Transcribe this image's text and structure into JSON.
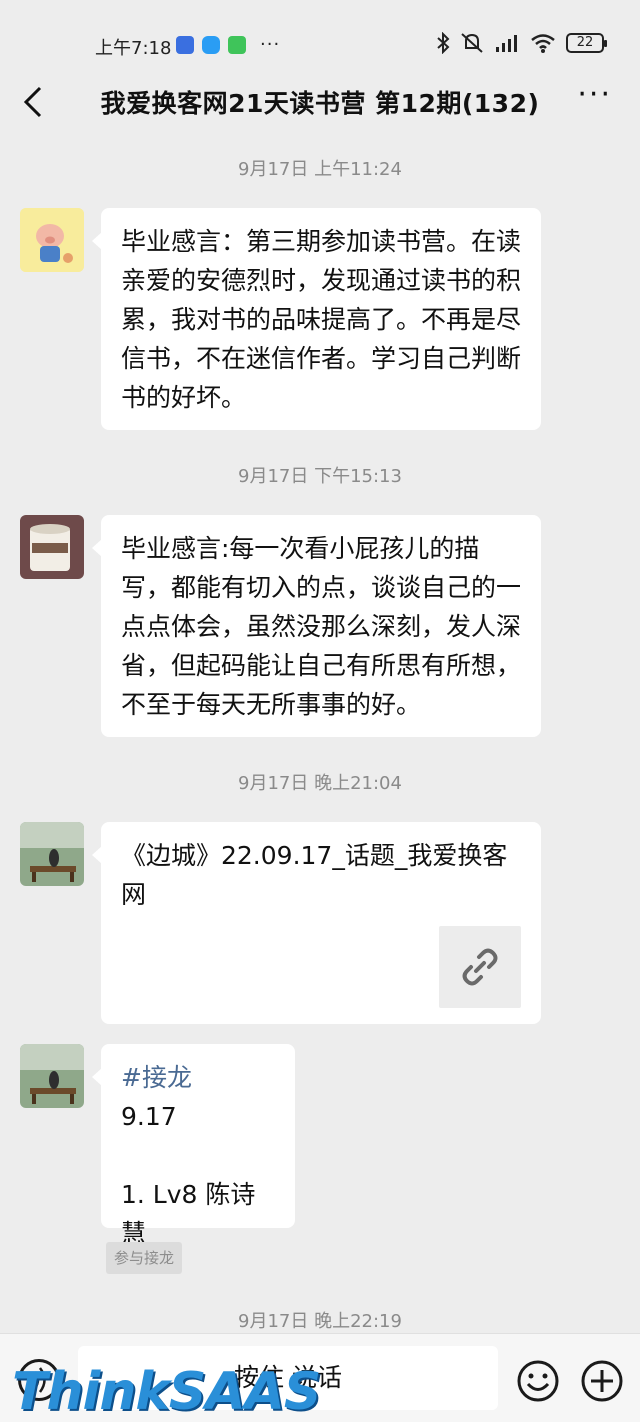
{
  "status_bar": {
    "time": "上午7:18",
    "more": "···",
    "battery": "22"
  },
  "header": {
    "title": "我爱换客网21天读书营 第12期(132)",
    "more": "···"
  },
  "messages": [
    {
      "timestamp": "9月17日 上午11:24",
      "text": "毕业感言：第三期参加读书营。在读亲爱的安德烈时，发现通过读书的积累，我对书的品味提高了。不再是尽信书，不在迷信作者。学习自己判断书的好坏。"
    },
    {
      "timestamp": "9月17日 下午15:13",
      "text": "毕业感言:每一次看小屁孩儿的描写，都能有切入的点，谈谈自己的一点点体会，虽然没那么深刻，发人深省，但起码能让自己有所思有所想，不至于每天无所事事的好。"
    },
    {
      "timestamp": "9月17日 晚上21:04",
      "text": "《边城》22.09.17_话题_我爱换客网"
    },
    {
      "tag": "#接龙",
      "line1": "9.17",
      "line2": "1. Lv8 陈诗慧",
      "join_label": "参与接龙"
    }
  ],
  "last_timestamp": "9月17日 晚上22:19",
  "input_bar": {
    "hold_to_talk": "按住 说话"
  },
  "watermark": "ThinkSAAS",
  "colors": {
    "background": "#ededed",
    "bubble": "#ffffff",
    "tag": "#4a6a93",
    "timestamp": "#8a8a8a"
  }
}
